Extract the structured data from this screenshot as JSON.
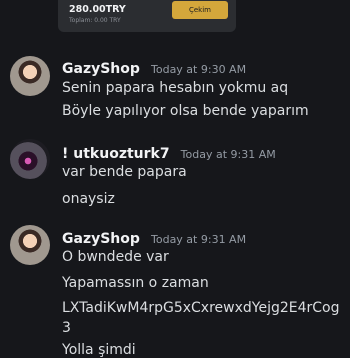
{
  "embed": {
    "balance": "280.00TRY",
    "sub": "Toplam: 0.00 TRY",
    "button_label": "Çekim"
  },
  "messages": [
    {
      "username": "GazyShop",
      "time": "Today at 9:30 AM",
      "lines": [
        "Senin papara hesabın yokmu aq",
        "Böyle yapılıyor olsa bende yaparım"
      ]
    },
    {
      "username": "! utkuozturk7",
      "time": "Today at 9:31 AM",
      "lines": [
        "var bende papara",
        "onaysiz"
      ]
    },
    {
      "username": "GazyShop",
      "time": "Today at 9:31 AM",
      "lines": [
        "O bwndede var",
        "Yapamassın o zaman",
        "LXTadiKwM4rpG5xCxrewxdYejg2E4rCog",
        "3",
        "Yolla şimdi"
      ]
    }
  ]
}
